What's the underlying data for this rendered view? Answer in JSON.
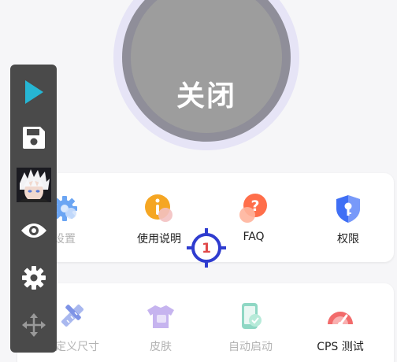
{
  "main_toggle": {
    "label": "关闭"
  },
  "card_primary": {
    "items": [
      {
        "label": "设置",
        "icon": "gear-icon",
        "color": "#5b9cf2"
      },
      {
        "label": "使用说明",
        "icon": "info-icon",
        "color": "#f5a623"
      },
      {
        "label": "FAQ",
        "icon": "question-icon",
        "color": "#ff6e4a"
      },
      {
        "label": "权限",
        "icon": "shield-key-icon",
        "color": "#3f6ff5"
      }
    ]
  },
  "card_secondary": {
    "items": [
      {
        "label": "自定义尺寸",
        "icon": "ruler-pencil-icon",
        "color": "#a9b8ef"
      },
      {
        "label": "皮肤",
        "icon": "shirt-icon",
        "color": "#c6b4ef"
      },
      {
        "label": "自动启动",
        "icon": "phone-icon",
        "color": "#8fd7c4"
      },
      {
        "label": "CPS 测试",
        "icon": "speedometer-icon",
        "color": "#f26b6b"
      }
    ]
  },
  "toolbar": {
    "buttons": [
      "play-icon",
      "save-icon",
      "avatar",
      "eye-icon",
      "gear-icon",
      "move-icon"
    ],
    "accent": "#26b6d4"
  },
  "click_target": {
    "number": "1",
    "color": "#2f3ccf",
    "number_color": "#e04848"
  }
}
